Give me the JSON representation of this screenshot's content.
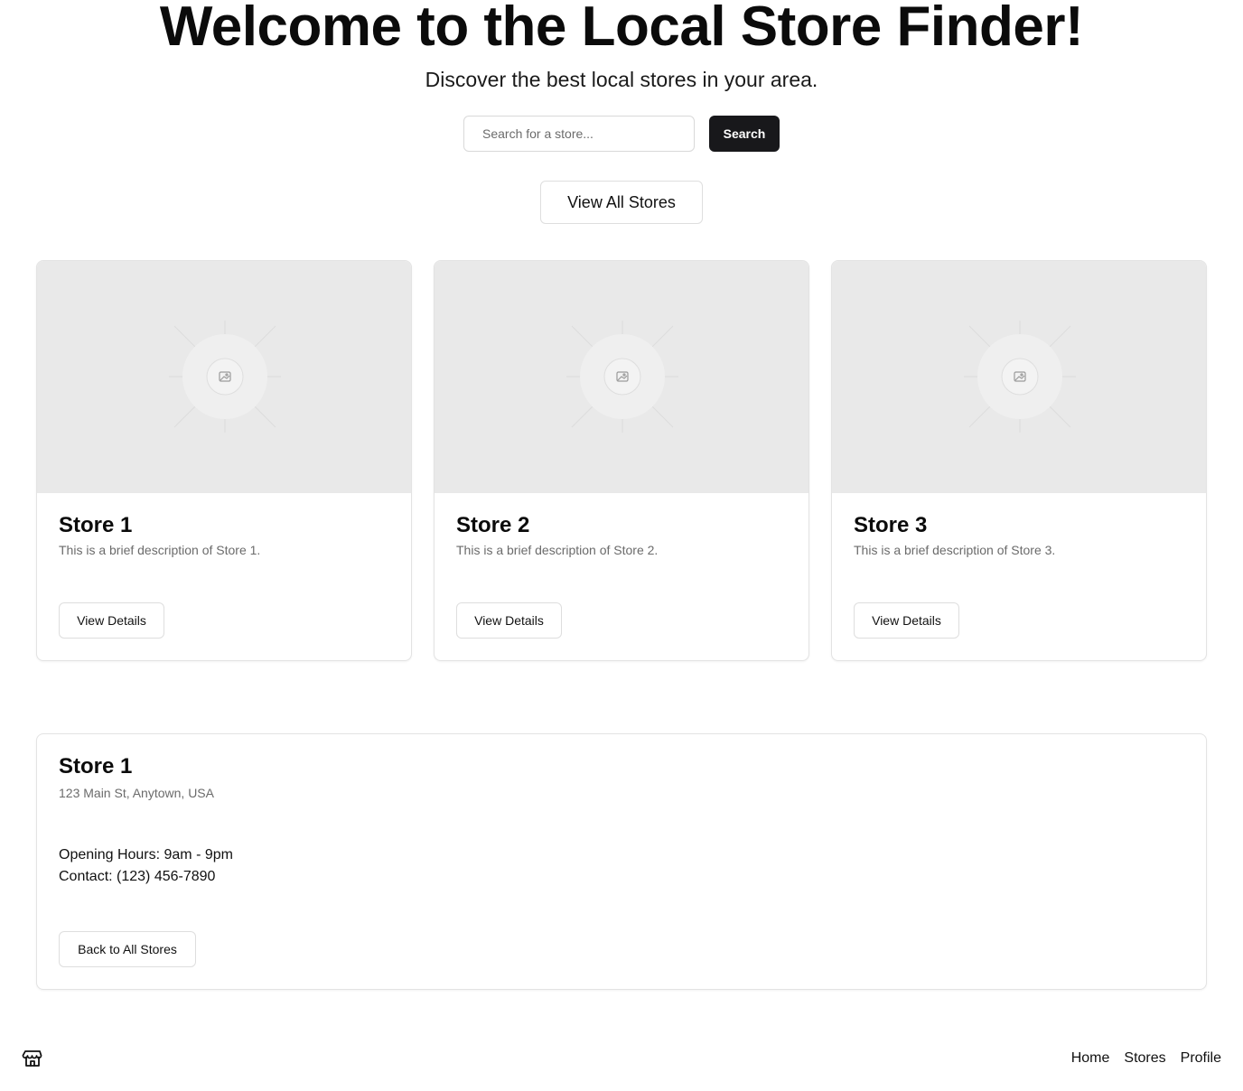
{
  "hero": {
    "title": "Welcome to the Local Store Finder!",
    "subtitle": "Discover the best local stores in your area."
  },
  "search": {
    "placeholder": "Search for a store...",
    "value": "",
    "button_label": "Search"
  },
  "view_all_label": "View All Stores",
  "stores": [
    {
      "name": "Store 1",
      "description": "This is a brief description of Store 1.",
      "button_label": "View Details",
      "image_icon": "image-placeholder-icon"
    },
    {
      "name": "Store 2",
      "description": "This is a brief description of Store 2.",
      "button_label": "View Details",
      "image_icon": "image-placeholder-icon"
    },
    {
      "name": "Store 3",
      "description": "This is a brief description of Store 3.",
      "button_label": "View Details",
      "image_icon": "image-placeholder-icon"
    }
  ],
  "detail": {
    "name": "Store 1",
    "address": "123 Main St, Anytown, USA",
    "hours": "Opening Hours: 9am - 9pm",
    "contact": "Contact: (123) 456-7890",
    "back_label": "Back to All Stores"
  },
  "footer": {
    "logo_icon": "store-icon",
    "links": [
      "Home",
      "Stores",
      "Profile"
    ]
  },
  "colors": {
    "primary_button": "#18181b",
    "image_placeholder": "#e9e9e9",
    "muted_text": "#6b6b6b",
    "border": "#e3e3e3"
  }
}
